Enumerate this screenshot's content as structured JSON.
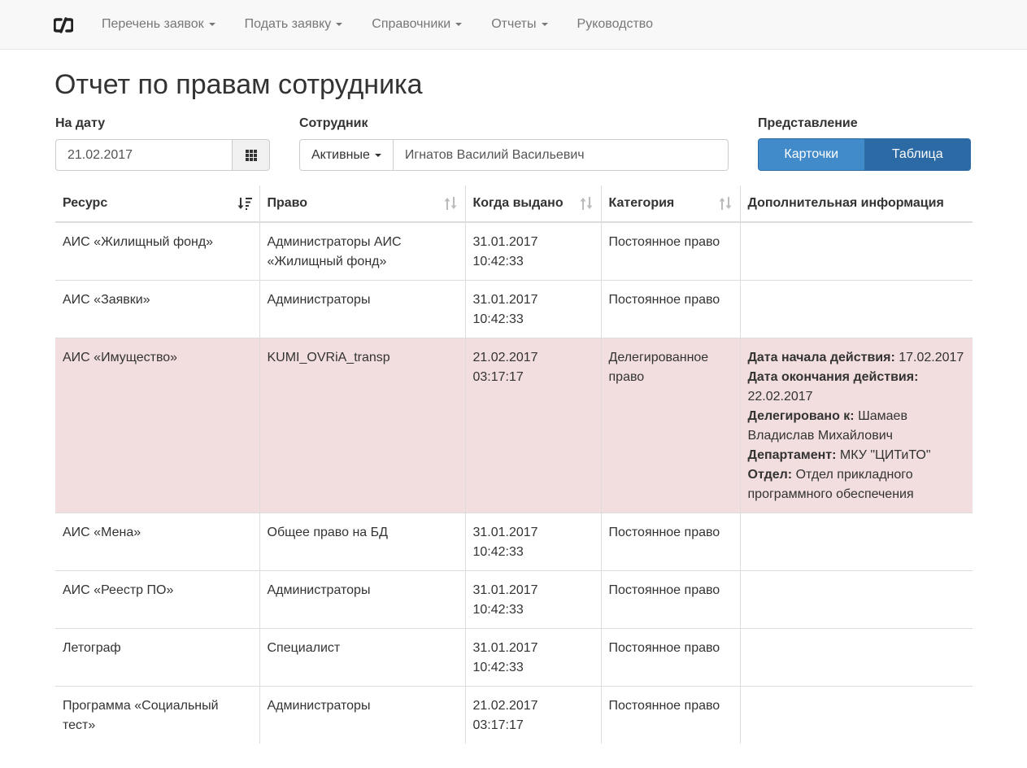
{
  "nav": {
    "items": [
      {
        "label": "Перечень заявок",
        "dropdown": true
      },
      {
        "label": "Подать заявку",
        "dropdown": true
      },
      {
        "label": "Справочники",
        "dropdown": true
      },
      {
        "label": "Отчеты",
        "dropdown": true
      },
      {
        "label": "Руководство",
        "dropdown": false
      }
    ]
  },
  "page": {
    "title": "Отчет по правам сотрудника"
  },
  "filters": {
    "date_label": "На дату",
    "date_value": "21.02.2017",
    "employee_label": "Сотрудник",
    "employee_filter": "Активные",
    "employee_value": "Игнатов Василий Васильевич",
    "view_label": "Представление",
    "view_cards": "Карточки",
    "view_table": "Таблица",
    "view_selected": "Таблица"
  },
  "table": {
    "headers": [
      "Ресурс",
      "Право",
      "Когда выдано",
      "Категория",
      "Дополнительная информация"
    ],
    "sorted_column": "Ресурс",
    "rows": [
      {
        "resource": "АИС «Жилищный фонд»",
        "right": "Администраторы АИС «Жилищный фонд»",
        "date": "31.01.2017",
        "time": "10:42:33",
        "category": "Постоянное право",
        "highlight": false
      },
      {
        "resource": "АИС «Заявки»",
        "right": "Администраторы",
        "date": "31.01.2017",
        "time": "10:42:33",
        "category": "Постоянное право",
        "highlight": false
      },
      {
        "resource": "АИС «Имущество»",
        "right": "KUMI_OVRiA_transp",
        "date": "21.02.2017",
        "time": "03:17:17",
        "category": "Делегированное право",
        "highlight": true,
        "info": [
          {
            "k": "Дата начала действия:",
            "v": "17.02.2017"
          },
          {
            "k": "Дата окончания действия:",
            "v": "22.02.2017"
          },
          {
            "k": "Делегировано к:",
            "v": "Шамаев Владислав Михайлович"
          },
          {
            "k": "Департамент:",
            "v": "МКУ \"ЦИТиТО\""
          },
          {
            "k": "Отдел:",
            "v": "Отдел прикладного программного обеспечения"
          }
        ]
      },
      {
        "resource": "АИС «Мена»",
        "right": "Общее право на БД",
        "date": "31.01.2017",
        "time": "10:42:33",
        "category": "Постоянное право",
        "highlight": false
      },
      {
        "resource": "АИС «Реестр ПО»",
        "right": "Администраторы",
        "date": "31.01.2017",
        "time": "10:42:33",
        "category": "Постоянное право",
        "highlight": false
      },
      {
        "resource": "Летограф",
        "right": "Специалист",
        "date": "31.01.2017",
        "time": "10:42:33",
        "category": "Постоянное право",
        "highlight": false
      },
      {
        "resource": "Программа «Социальный тест»",
        "right": "Администраторы",
        "date": "21.02.2017",
        "time": "03:17:17",
        "category": "Постоянное право",
        "highlight": false
      }
    ]
  },
  "colors": {
    "primary": "#428bca",
    "primary_active": "#2c6aa5",
    "danger_row": "#f2dede",
    "navbar_bg": "#f8f8f8"
  }
}
